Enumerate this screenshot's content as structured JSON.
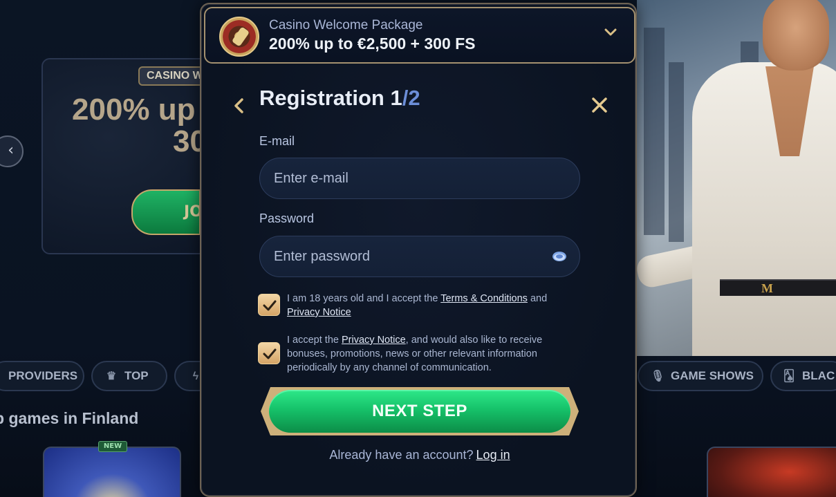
{
  "background": {
    "banner_badge": "CASINO W",
    "banner_headline_line1": "200% up",
    "banner_headline_line2": "30",
    "banner_join": "JO",
    "categories": [
      {
        "label": "PROVIDERS",
        "icon": "none"
      },
      {
        "label": "TOP",
        "icon": "crown-icon"
      },
      {
        "label": "",
        "icon": "bolt-icon"
      },
      {
        "label": "GAME SHOWS",
        "icon": "microphone-icon"
      },
      {
        "label": "BLAC",
        "icon": "cards-icon"
      }
    ],
    "section_title": "p games in Finland",
    "new_tag": "NEW",
    "belt_letter": "M"
  },
  "promo": {
    "subtitle": "Casino Welcome Package",
    "headline": "200% up to €2,500 + 300 FS",
    "icon": "roulette-icon"
  },
  "registration": {
    "title": "Registration ",
    "step": "1",
    "total": "/2",
    "email_label": "E-mail",
    "email_placeholder": "Enter e-mail",
    "password_label": "Password",
    "password_placeholder": "Enter password",
    "consent1": {
      "prefix": "I am 18 years old and I accept the ",
      "terms_link": "Terms & Conditions",
      "middle": " and",
      "privacy_link": "Privacy Notice",
      "checked": true
    },
    "consent2": {
      "prefix": "I accept the ",
      "privacy_link": "Privacy Notice",
      "suffix": ", and would also like to receive bonuses, promotions, news or other relevant information periodically by any channel of communication.",
      "checked": true
    },
    "next_button": "NEXT STEP",
    "login_prompt": "Already have an account?",
    "login_link": "Log in"
  },
  "colors": {
    "accent_gold": "#cdb07a",
    "button_green": "#16c26a",
    "step_blue": "#6c8ed8"
  }
}
